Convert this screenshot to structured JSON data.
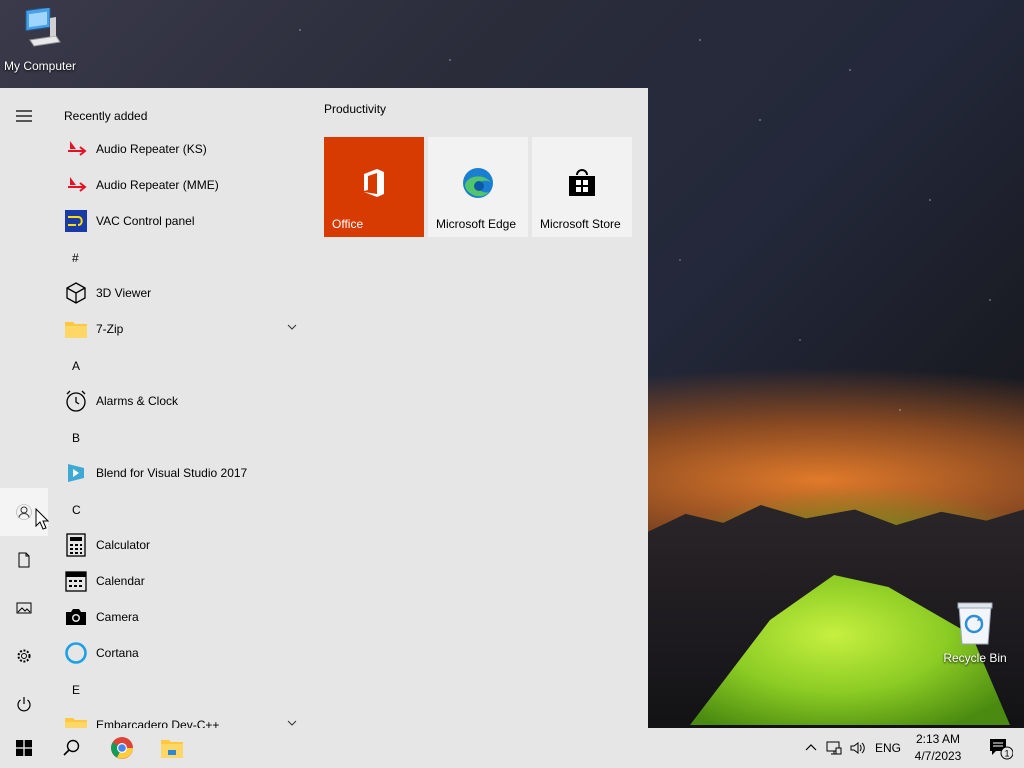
{
  "desktop": {
    "icons": [
      {
        "label": "My Computer",
        "icon": "computer-icon"
      },
      {
        "label": "Recycle Bin",
        "icon": "recycle-bin-icon"
      }
    ]
  },
  "start_menu": {
    "rail": {
      "menu": "hamburger-icon",
      "account": "user-icon",
      "documents": "document-icon",
      "pictures": "pictures-icon",
      "settings": "gear-icon",
      "power": "power-icon"
    },
    "recently_added_label": "Recently added",
    "recent": [
      {
        "name": "Audio Repeater (KS)",
        "icon": "audio-repeater-icon"
      },
      {
        "name": "Audio Repeater (MME)",
        "icon": "audio-repeater-icon"
      },
      {
        "name": "VAC Control panel",
        "icon": "vac-icon"
      }
    ],
    "groups": [
      {
        "letter": "#",
        "apps": [
          {
            "name": "3D Viewer",
            "icon": "cube-icon"
          },
          {
            "name": "7-Zip",
            "icon": "folder-icon",
            "expandable": true
          }
        ]
      },
      {
        "letter": "A",
        "apps": [
          {
            "name": "Alarms & Clock",
            "icon": "alarm-clock-icon"
          }
        ]
      },
      {
        "letter": "B",
        "apps": [
          {
            "name": "Blend for Visual Studio 2017",
            "icon": "blend-icon"
          }
        ]
      },
      {
        "letter": "C",
        "apps": [
          {
            "name": "Calculator",
            "icon": "calculator-icon"
          },
          {
            "name": "Calendar",
            "icon": "calendar-icon"
          },
          {
            "name": "Camera",
            "icon": "camera-icon"
          },
          {
            "name": "Cortana",
            "icon": "cortana-icon"
          }
        ]
      },
      {
        "letter": "E",
        "apps": [
          {
            "name": "Embarcadero Dev-C++",
            "icon": "folder-icon",
            "expandable": true
          }
        ]
      }
    ],
    "tiles_group_title": "Productivity",
    "tiles": [
      {
        "label": "Office",
        "icon": "office-icon",
        "color": "#d83b01"
      },
      {
        "label": "Microsoft Edge",
        "icon": "edge-icon",
        "color": "#f2f2f2"
      },
      {
        "label": "Microsoft Store",
        "icon": "store-icon",
        "color": "#f2f2f2"
      }
    ]
  },
  "taskbar": {
    "start": "windows-logo-icon",
    "search": "search-icon",
    "pinned": [
      "chrome-icon",
      "file-explorer-icon"
    ],
    "tray": {
      "chevron": "chevron-up-icon",
      "network": "network-icon",
      "volume": "volume-icon",
      "language": "ENG",
      "time": "2:13 AM",
      "date": "4/7/2023",
      "notifications_count": "1"
    }
  }
}
